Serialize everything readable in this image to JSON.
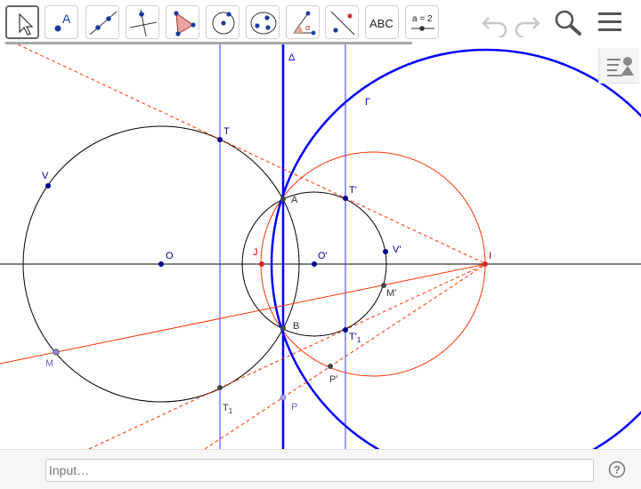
{
  "toolbar": {
    "tools": [
      {
        "name": "move-tool",
        "selected": true
      },
      {
        "name": "point-tool",
        "label": "A"
      },
      {
        "name": "line-tool"
      },
      {
        "name": "perpendicular-line-tool"
      },
      {
        "name": "polygon-tool"
      },
      {
        "name": "circle-center-point-tool"
      },
      {
        "name": "conic-through-points-tool"
      },
      {
        "name": "angle-tool",
        "label": "α"
      },
      {
        "name": "reflect-tool"
      },
      {
        "name": "text-tool",
        "label": "ABC"
      },
      {
        "name": "slider-tool",
        "label": "a = 2"
      }
    ],
    "undo_icon": "undo-icon",
    "redo_icon": "redo-icon",
    "search_icon": "search-icon",
    "menu_icon": "hamburger-menu-icon"
  },
  "algebra_toggle_icon": "algebra-view-icon",
  "construction": {
    "labels": {
      "Delta": "Δ",
      "Gamma": "Γ",
      "T": "T",
      "T_prime": "T'",
      "V": "V",
      "V_prime": "V'",
      "A": "A",
      "B": "B",
      "O": "O",
      "O_prime": "O'",
      "J": "J",
      "I": "I",
      "M": "M",
      "M_prime": "M'",
      "T1": "T",
      "T1_sub": "1",
      "T1_prime": "T'",
      "T1_prime_sub": "1",
      "P": "P",
      "P_prime": "P'"
    },
    "colors": {
      "black": "#000000",
      "blue": "#0000ff",
      "dark_blue": "#00008b",
      "red": "#ff3300",
      "label_blue": "#0000cc",
      "label_red": "#cc0000",
      "point_gray": "#6666cc"
    }
  },
  "input_bar": {
    "placeholder": "Input…",
    "help_icon": "help-icon"
  }
}
